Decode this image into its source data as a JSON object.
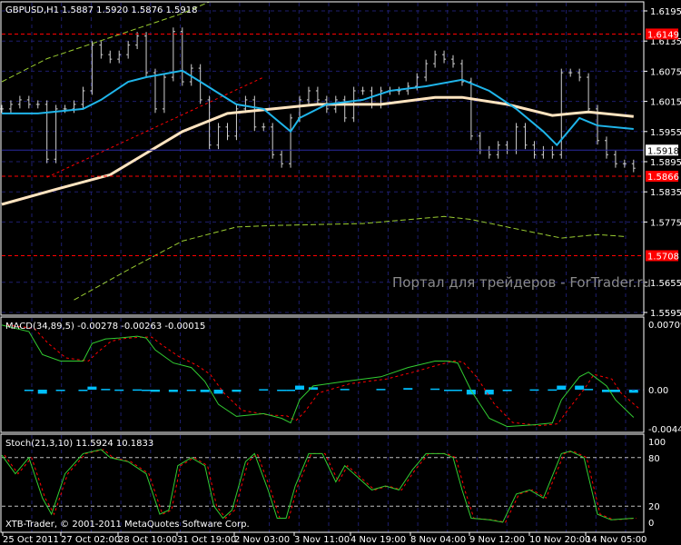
{
  "header": {
    "symbol_tf": "GBPUSD,H1",
    "ohlc": "1.5887 1.5920 1.5876 1.5918"
  },
  "watermark": "Портал для трейдеров - ForTrader.ru",
  "copyright": "XTB-Trader, © 2001-2011 MetaQuotes Software Corp.",
  "colors": {
    "bars": "#d0d0d0",
    "ma_fast": "#1fb5ea",
    "ma_slow": "#ffe4c0",
    "envelope": "#9acd32",
    "level": "#ff0000",
    "grid": "#1e1e6e",
    "macd": "#32cd32",
    "signal": "#ff0000",
    "histogram": "#00bfff"
  },
  "chart_data": [
    {
      "type": "line",
      "title": "GBPUSD,H1",
      "price_axis": {
        "ticks": [
          "1.6195",
          "1.6135",
          "1.6075",
          "1.6015",
          "1.5955",
          "1.5895",
          "1.5835",
          "1.5775",
          "1.5655",
          "1.5595"
        ],
        "range": [
          1.5595,
          1.6195
        ]
      },
      "price_labels": [
        {
          "text": "1.6149",
          "value": 1.6149,
          "kind": "level"
        },
        {
          "text": "1.5918",
          "value": 1.5918,
          "kind": "bid"
        },
        {
          "text": "1.5866",
          "value": 1.5866,
          "kind": "level"
        },
        {
          "text": "1.5708",
          "value": 1.5708,
          "kind": "level"
        }
      ],
      "close": [
        1.6,
        1.6009,
        1.6018,
        1.6009,
        1.6009,
        1.59,
        1.6,
        1.6,
        1.6009,
        1.6036,
        1.6127,
        1.6108,
        1.6099,
        1.6108,
        1.6127,
        1.6145,
        1.6072,
        1.6,
        1.6063,
        1.6154,
        1.6054,
        1.6081,
        1.6018,
        1.5928,
        1.5964,
        1.5946,
        1.6,
        1.6018,
        1.5964,
        1.5964,
        1.5909,
        1.5891,
        1.5982,
        1.6018,
        1.6036,
        1.6018,
        1.6,
        1.6018,
        1.5982,
        1.6036,
        1.6036,
        1.6009,
        1.6036,
        1.6036,
        1.6036,
        1.6045,
        1.6063,
        1.609,
        1.6108,
        1.6099,
        1.609,
        1.6054,
        1.5946,
        1.5918,
        1.5909,
        1.5928,
        1.5918,
        1.5964,
        1.5928,
        1.5909,
        1.5918,
        1.5909,
        1.6072,
        1.6072,
        1.6063,
        1.6,
        1.5937,
        1.5909,
        1.5891,
        1.5891,
        1.5882
      ],
      "ma_fast": [
        [
          0,
          1.5991
        ],
        [
          4,
          1.5991
        ],
        [
          9,
          1.6
        ],
        [
          11,
          1.6018
        ],
        [
          14,
          1.6054
        ],
        [
          16,
          1.6063
        ],
        [
          20,
          1.6076
        ],
        [
          22,
          1.6054
        ],
        [
          26,
          1.6009
        ],
        [
          29,
          1.6
        ],
        [
          32,
          1.5955
        ],
        [
          33,
          1.5982
        ],
        [
          36,
          1.6009
        ],
        [
          40,
          1.6018
        ],
        [
          43,
          1.6036
        ],
        [
          47,
          1.6045
        ],
        [
          51,
          1.6058
        ],
        [
          54,
          1.6036
        ],
        [
          57,
          1.6
        ],
        [
          60,
          1.5955
        ],
        [
          61.5,
          1.5928
        ],
        [
          64,
          1.5982
        ],
        [
          66,
          1.5967
        ],
        [
          70,
          1.596
        ]
      ],
      "ma_slow": [
        [
          0,
          1.581
        ],
        [
          6,
          1.584
        ],
        [
          12,
          1.5869
        ],
        [
          20,
          1.5955
        ],
        [
          25,
          1.5991
        ],
        [
          30,
          1.6
        ],
        [
          35,
          1.6009
        ],
        [
          42,
          1.6009
        ],
        [
          48,
          1.6023
        ],
        [
          51,
          1.6023
        ],
        [
          56,
          1.6009
        ],
        [
          61,
          1.5987
        ],
        [
          65,
          1.5994
        ],
        [
          70,
          1.5985
        ]
      ],
      "envelope_upper": [
        [
          0,
          1.6054
        ],
        [
          5,
          1.61
        ],
        [
          10,
          1.613
        ],
        [
          15,
          1.616
        ],
        [
          20,
          1.619
        ],
        [
          23,
          1.6213
        ]
      ],
      "envelope_lower": [
        [
          8,
          1.562
        ],
        [
          14,
          1.568
        ],
        [
          20,
          1.5737
        ],
        [
          26,
          1.5765
        ],
        [
          30,
          1.5768
        ],
        [
          40,
          1.5772
        ],
        [
          49,
          1.5786
        ],
        [
          52,
          1.578
        ],
        [
          56,
          1.5765
        ],
        [
          62,
          1.5743
        ],
        [
          66,
          1.575
        ],
        [
          69,
          1.5746
        ]
      ],
      "trendline": [
        [
          5,
          1.5864
        ],
        [
          29,
          1.6063
        ]
      ],
      "time_labels": [
        "25 Oct 2011",
        "27 Oct 02:00",
        "28 Oct 10:00",
        "31 Oct 19:00",
        "2 Nov 03:00",
        "3 Nov 11:00",
        "4 Nov 19:00",
        "8 Nov 04:00",
        "9 Nov 12:00",
        "10 Nov 20:00",
        "14 Nov 05:00"
      ]
    },
    {
      "type": "line",
      "title": "MACD(34,89,5) -0.00278 -0.00263 -0.00015",
      "ticks": [
        "0.00709",
        "0.00",
        "-0.0044"
      ],
      "range": [
        -0.0044,
        0.00709
      ],
      "macd": [
        [
          0,
          0.007
        ],
        [
          3,
          0.0063
        ],
        [
          4.5,
          0.0038
        ],
        [
          6.5,
          0.0031
        ],
        [
          9,
          0.0031
        ],
        [
          10,
          0.005
        ],
        [
          11.5,
          0.0055
        ],
        [
          13,
          0.0056
        ],
        [
          15,
          0.0058
        ],
        [
          16,
          0.0056
        ],
        [
          17,
          0.0043
        ],
        [
          19,
          0.0029
        ],
        [
          21,
          0.0024
        ],
        [
          22.5,
          0.0009
        ],
        [
          24,
          -0.0016
        ],
        [
          26,
          -0.0029
        ],
        [
          29,
          -0.0026
        ],
        [
          31,
          -0.0031
        ],
        [
          32,
          -0.0036
        ],
        [
          33,
          -0.0011
        ],
        [
          34.5,
          0.0004
        ],
        [
          38,
          0.0009
        ],
        [
          42,
          0.0014
        ],
        [
          45,
          0.0024
        ],
        [
          48,
          0.0031
        ],
        [
          49.5,
          0.0031
        ],
        [
          50.5,
          0.0029
        ],
        [
          52,
          -0.0001
        ],
        [
          54,
          -0.0031
        ],
        [
          56,
          -0.004
        ],
        [
          59,
          -0.0038
        ],
        [
          61,
          -0.0036
        ],
        [
          62,
          -0.0011
        ],
        [
          64,
          0.0014
        ],
        [
          65,
          0.0019
        ],
        [
          67,
          0.0004
        ],
        [
          68,
          -0.0011
        ],
        [
          70,
          -0.003
        ]
      ]
    },
    {
      "type": "line",
      "title": "Stoch(21,3,10) 11.5924 10.1833",
      "ticks": [
        "100",
        "80",
        "20",
        "0"
      ],
      "range": [
        0,
        100
      ],
      "levels": [
        80,
        20
      ],
      "main": [
        [
          0,
          83
        ],
        [
          1.5,
          60
        ],
        [
          3,
          80
        ],
        [
          4.5,
          30
        ],
        [
          5.5,
          10
        ],
        [
          7,
          60
        ],
        [
          9,
          85
        ],
        [
          11,
          90
        ],
        [
          12,
          80
        ],
        [
          14,
          75
        ],
        [
          16,
          60
        ],
        [
          17.5,
          10
        ],
        [
          18.5,
          15
        ],
        [
          19.5,
          70
        ],
        [
          21,
          80
        ],
        [
          22.5,
          70
        ],
        [
          23.5,
          20
        ],
        [
          24.5,
          5
        ],
        [
          25.5,
          15
        ],
        [
          27,
          75
        ],
        [
          28,
          85
        ],
        [
          29.5,
          40
        ],
        [
          30.5,
          5
        ],
        [
          31.5,
          5
        ],
        [
          32.5,
          45
        ],
        [
          34,
          85
        ],
        [
          35.5,
          85
        ],
        [
          37,
          50
        ],
        [
          38,
          70
        ],
        [
          39.5,
          55
        ],
        [
          41,
          40
        ],
        [
          42.5,
          45
        ],
        [
          44,
          40
        ],
        [
          45.5,
          65
        ],
        [
          47,
          85
        ],
        [
          49,
          85
        ],
        [
          50,
          80
        ],
        [
          51,
          40
        ],
        [
          52,
          5
        ],
        [
          54,
          3
        ],
        [
          55.5,
          0
        ],
        [
          57,
          35
        ],
        [
          58.5,
          40
        ],
        [
          60,
          30
        ],
        [
          62,
          85
        ],
        [
          63,
          88
        ],
        [
          64.5,
          80
        ],
        [
          66,
          10
        ],
        [
          67.5,
          3
        ],
        [
          70,
          5
        ]
      ]
    }
  ]
}
